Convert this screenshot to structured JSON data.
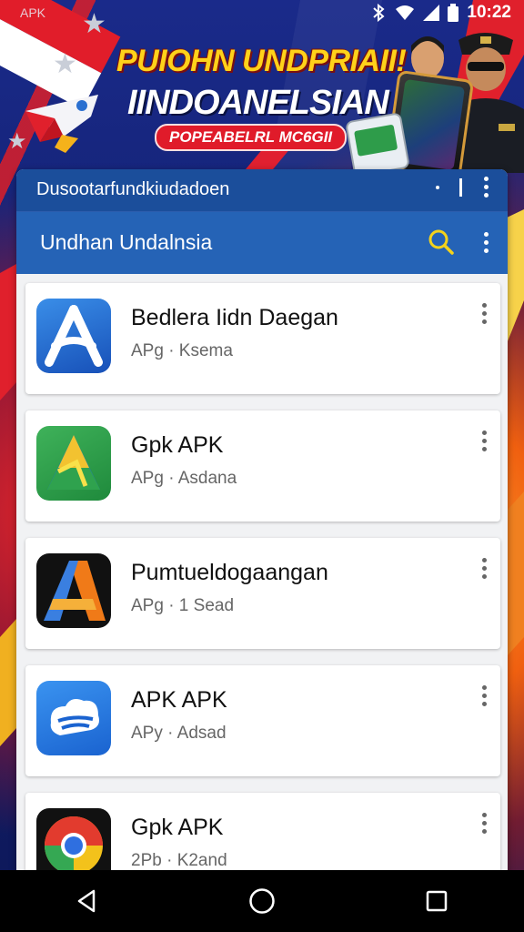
{
  "status_bar": {
    "watermark": "APK",
    "time": "10:22"
  },
  "banner": {
    "headline": "PUIOHN UNDPRIAII!",
    "subheadline": "IINDOANELSIAN",
    "pill": "POPEABELRL MC6GII"
  },
  "app": {
    "title": "Dusootarfundkiudadoen",
    "toolbar_title": "Undhan Undalnsia",
    "colors": {
      "title_bar": "#1b4e9b",
      "toolbar": "#2563b6",
      "search_icon": "#f3d21c"
    }
  },
  "list": {
    "items": [
      {
        "name": "Bedlera Iidn Daegan",
        "meta": "APg · Ksema",
        "icon": "app-store-a-icon"
      },
      {
        "name": "Gpk APK",
        "meta": "APg · Asdana",
        "icon": "green-triangle-icon"
      },
      {
        "name": "Pumtueldogaangan",
        "meta": "APg · 1 Sead",
        "icon": "orange-a-icon"
      },
      {
        "name": "APK APK",
        "meta": "APy · Adsad",
        "icon": "blue-cloud-icon"
      },
      {
        "name": "Gpk APK",
        "meta": "2Pb · K2and",
        "icon": "chrome-icon"
      }
    ]
  },
  "nav_bar": {
    "back": "back-icon",
    "home": "home-icon",
    "recents": "recents-icon"
  }
}
